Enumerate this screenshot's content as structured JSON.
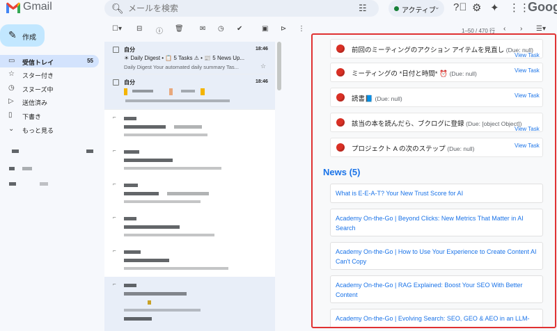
{
  "header": {
    "app_name": "Gmail",
    "search_placeholder": "メールを検索",
    "status_label": "アクティブ",
    "brand": "Googl"
  },
  "sidebar": {
    "compose_label": "作成",
    "items": [
      {
        "label": "受信トレイ",
        "count": "55"
      },
      {
        "label": "スター付き"
      },
      {
        "label": "スヌーズ中"
      },
      {
        "label": "送信済み"
      },
      {
        "label": "下書き"
      },
      {
        "label": "もっと見る"
      }
    ]
  },
  "toolbar": {
    "pager": "1–50 / 470 行"
  },
  "mail_list": {
    "rows": [
      {
        "sender": "自分",
        "time": "18:46",
        "subject": "☀ Daily Digest • 📋 5 Tasks ⚠ • 📰 5 News Up...",
        "snippet": "Daily Digest Your automated daily summary Tas..."
      },
      {
        "sender": "自分",
        "time": "18:46"
      }
    ]
  },
  "panel": {
    "tasks": [
      {
        "title": "前回のミーティングのアクション アイテムを見直し",
        "due": "(Due: null)",
        "link": "View Task"
      },
      {
        "title": "ミーティングの *日付と時間* ⏰",
        "due": "(Due: null)",
        "link": "View Task"
      },
      {
        "title": "読書📘",
        "due": "(Due: null)",
        "link": "View Task"
      },
      {
        "title": "該当の本を読んだら、ブクログに登録",
        "due": "(Due: [object Object])",
        "link": "View Task"
      },
      {
        "title": "プロジェクト A の次のステップ",
        "due": "(Due: null)",
        "link": "View Task"
      }
    ],
    "news_heading": "News (5)",
    "news": [
      "What is E-E-A-T? Your New Trust Score for AI",
      "Academy On-the-Go | Beyond Clicks: New Metrics That Matter in AI Search",
      "Academy On-the-Go | How to Use Your Experience to Create Content AI Can't Copy",
      "Academy On-the-Go | RAG Explained: Boost Your SEO With Better Content",
      "Academy On-the-Go | Evolving Search: SEO, GEO & AEO in an LLM-"
    ]
  },
  "colors": {
    "accent": "#1a73e8",
    "panel_border": "#e03131",
    "compose_bg": "#c2e7ff",
    "active_nav": "#d3e3fd",
    "status_green": "#188038",
    "task_dot": "#d93025"
  },
  "icons": [
    "gmail-logo",
    "search-icon",
    "tune-icon",
    "help-icon",
    "gear-icon",
    "sparkle-icon",
    "apps-icon",
    "pencil-icon",
    "inbox-icon",
    "star-icon",
    "clock-icon",
    "send-icon",
    "file-icon",
    "chevron-down-icon"
  ]
}
